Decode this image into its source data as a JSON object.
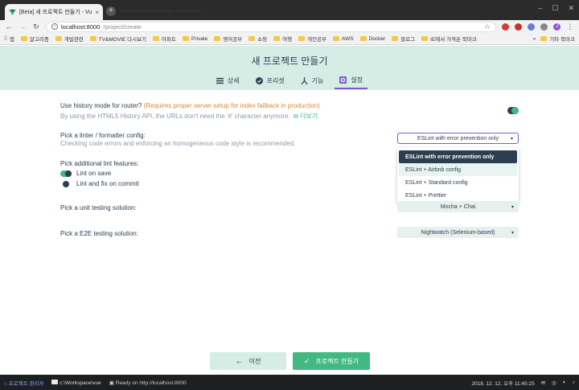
{
  "browser": {
    "tab_title": "[Beta] 새 프로젝트 만들기 - Vue",
    "tab_close": "×",
    "new_tab": "+",
    "ghost_tabs": "......   ......   ......   ......   ......   ......",
    "url_host": "localhost:8000",
    "url_path": "/project/create",
    "profile_initial": "J",
    "bookmarks": [
      "앱",
      "알고리즘",
      "개발관련",
      "TV&MOVIE 다시보기",
      "아파트",
      "Private",
      "영어공부",
      "쇼핑",
      "여행",
      "개인공부",
      "AWS",
      "Docker",
      "블로그",
      "IE에서 가져온 북마크"
    ],
    "bookmarks_more": "»",
    "other_bookmarks": "기타 북마크"
  },
  "header": {
    "title": "새 프로젝트 만들기",
    "tabs": [
      {
        "label": "상세",
        "icon": "list-icon"
      },
      {
        "label": "프리셋",
        "icon": "check-circle-icon"
      },
      {
        "label": "기능",
        "icon": "fork-icon"
      },
      {
        "label": "설정",
        "icon": "gear-icon"
      }
    ]
  },
  "history": {
    "title_prefix": "Use history mode for router?",
    "title_warning": "(Requires proper server setup for index fallback in production)",
    "desc": "By using the HTML5 History API, the URLs don't need the '#' character anymore.",
    "more": "더보기",
    "enabled": true
  },
  "linter": {
    "title": "Pick a linter / formatter config:",
    "desc": "Checking code errors and enforcing an homogeneous code style is recommended.",
    "selected": "ESLint with error prevention only",
    "options": [
      "ESLint with error prevention only",
      "ESLint + Airbnb config",
      "ESLint + Standard config",
      "ESLint + Prettier"
    ]
  },
  "lint_features": {
    "title": "Pick additional lint features:",
    "items": [
      {
        "label": "Lint on save",
        "enabled": true
      },
      {
        "label": "Lint and fix on commit",
        "enabled": false
      }
    ]
  },
  "unit_testing": {
    "title": "Pick a unit testing solution:",
    "selected": "Mocha + Chai"
  },
  "e2e_testing": {
    "title": "Pick a E2E testing solution:",
    "selected": "Nightwatch (Selenium-based)"
  },
  "actions": {
    "prev_label": "이전",
    "create_label": "프로젝트 만들기"
  },
  "statusbar": {
    "home_label": "프로젝트 관리자",
    "path": "c:\\Workspace\\vue",
    "status": "Ready on http://localhost:8000",
    "date": "2018. 12. 12. 오후 11:45:25"
  },
  "colors": {
    "accent": "#42b983",
    "dark": "#2c3e50",
    "header_bg": "#d6ede5",
    "active_tab": "#7a5bcc",
    "warning": "#e08a2c"
  }
}
